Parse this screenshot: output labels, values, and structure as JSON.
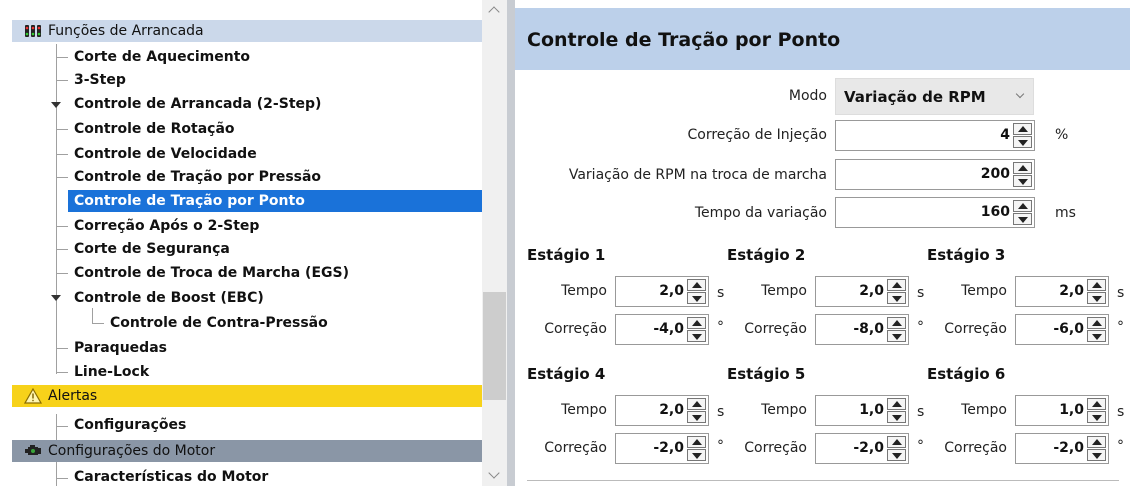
{
  "tree": {
    "categories": {
      "arrancada": "Funções de Arrancada",
      "alertas": "Alertas",
      "motor": "Configurações do Motor"
    },
    "items": {
      "corte_aquecimento": "Corte de Aquecimento",
      "three_step": "3-Step",
      "controle_arrancada": "Controle de Arrancada (2-Step)",
      "controle_rotacao": "Controle de Rotação",
      "controle_velocidade": "Controle de Velocidade",
      "tracao_pressao": "Controle de Tração por Pressão",
      "tracao_ponto": "Controle de Tração por Ponto",
      "correcao_apos": "Correção Após o 2-Step",
      "corte_seguranca": "Corte de Segurança",
      "troca_marcha": "Controle de Troca de Marcha (EGS)",
      "controle_boost": "Controle de Boost (EBC)",
      "contra_pressao": "Controle de Contra-Pressão",
      "paraquedas": "Paraquedas",
      "line_lock": "Line-Lock",
      "configuracoes": "Configurações",
      "caracteristicas": "Características do Motor"
    },
    "selected": "Controle de Tração por Ponto"
  },
  "panel": {
    "title": "Controle de Tração por Ponto",
    "modo": {
      "label": "Modo",
      "value": "Variação de RPM"
    },
    "correcao_injecao": {
      "label": "Correção de Injeção",
      "value": "4",
      "unit": "%"
    },
    "variacao_rpm": {
      "label": "Variação de RPM na troca de marcha",
      "value": "200"
    },
    "tempo_variacao": {
      "label": "Tempo da variação",
      "value": "160",
      "unit": "ms"
    },
    "tempo_label": "Tempo",
    "correcao_label": "Correção",
    "tempo_unit": "s",
    "correcao_unit": "°",
    "stages": [
      {
        "title": "Estágio 1",
        "tempo": "2,0",
        "correcao": "-4,0"
      },
      {
        "title": "Estágio 2",
        "tempo": "2,0",
        "correcao": "-8,0"
      },
      {
        "title": "Estágio 3",
        "tempo": "2,0",
        "correcao": "-6,0"
      },
      {
        "title": "Estágio 4",
        "tempo": "2,0",
        "correcao": "-2,0"
      },
      {
        "title": "Estágio 5",
        "tempo": "1,0",
        "correcao": "-2,0"
      },
      {
        "title": "Estágio 6",
        "tempo": "1,0",
        "correcao": "-2,0"
      }
    ]
  },
  "colors": {
    "selection": "#1a72d9",
    "category_blue": "#cbd8ea",
    "category_yellow": "#f7d21a",
    "category_gray": "#8a96a6",
    "panel_header": "#bcd0ea"
  },
  "icons": {
    "arrancada": "traffic-lights-icon",
    "alertas": "warning-triangle-icon",
    "motor": "engine-icon"
  }
}
